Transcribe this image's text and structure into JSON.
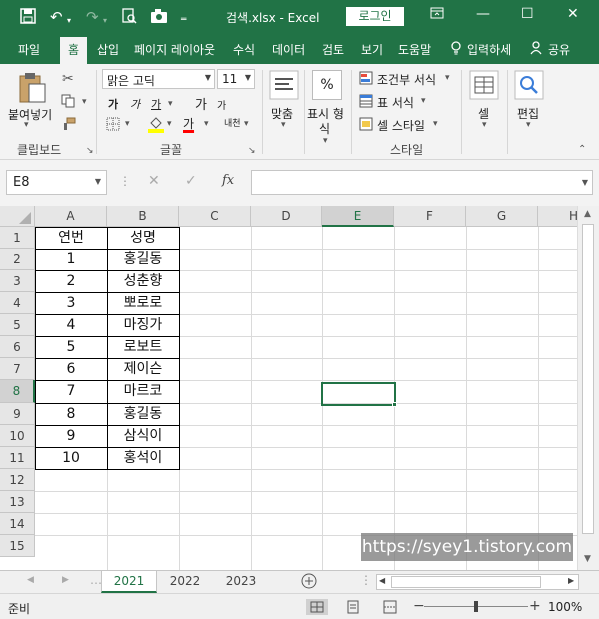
{
  "titlebar": {
    "title": "검색.xlsx  -  Excel",
    "login": "로그인",
    "save_icon": "save-icon",
    "undo_icon": "undo-icon",
    "redo_icon": "redo-icon"
  },
  "tabs": [
    "파일",
    "홈",
    "삽입",
    "페이지 레이아웃",
    "수식",
    "데이터",
    "검토",
    "보기",
    "도움말"
  ],
  "tell_me": "입력하세",
  "share": "공유",
  "ribbon": {
    "clipboard": {
      "paste": "붙여넣기",
      "label": "클립보드"
    },
    "font": {
      "name": "맑은 고딕",
      "size": "11",
      "bold": "가",
      "italic": "가",
      "underline": "가",
      "grow": "가",
      "shrink": "가",
      "fill_color": "#ffff00",
      "font_color": "#ff0000",
      "font_color_glyph": "가",
      "phonetic": "내천",
      "label": "글꼴"
    },
    "alignment": {
      "label": "맞춤"
    },
    "number": {
      "percent": "%",
      "label_line1": "표시 형",
      "label_line2": "식"
    },
    "styles": {
      "conditional": "조건부 서식",
      "table": "표 서식",
      "cell": "셀 스타일",
      "label": "스타일"
    },
    "cells": {
      "label": "셀"
    },
    "editing": {
      "label": "편집"
    }
  },
  "formula_bar": {
    "name_box": "E8",
    "fx": "fx",
    "value": ""
  },
  "columns": [
    "A",
    "B",
    "C",
    "D",
    "E",
    "F",
    "G",
    "H"
  ],
  "selected_column": "E",
  "selected_row": "8",
  "rows": [
    "1",
    "2",
    "3",
    "4",
    "5",
    "6",
    "7",
    "8",
    "9",
    "10",
    "11",
    "12",
    "13",
    "14",
    "15"
  ],
  "table": {
    "headers": [
      "연번",
      "성명"
    ],
    "data": [
      [
        "1",
        "홍길동"
      ],
      [
        "2",
        "성춘향"
      ],
      [
        "3",
        "뽀로로"
      ],
      [
        "4",
        "마징가"
      ],
      [
        "5",
        "로보트"
      ],
      [
        "6",
        "제이슨"
      ],
      [
        "7",
        "마르코"
      ],
      [
        "8",
        "홍길동"
      ],
      [
        "9",
        "삼식이"
      ],
      [
        "10",
        "홍석이"
      ]
    ]
  },
  "watermark": "https://syey1.tistory.com",
  "sheets": [
    "2021",
    "2022",
    "2023"
  ],
  "active_sheet": "2021",
  "status": {
    "ready": "준비",
    "zoom": "100%"
  },
  "accent": "#217346"
}
